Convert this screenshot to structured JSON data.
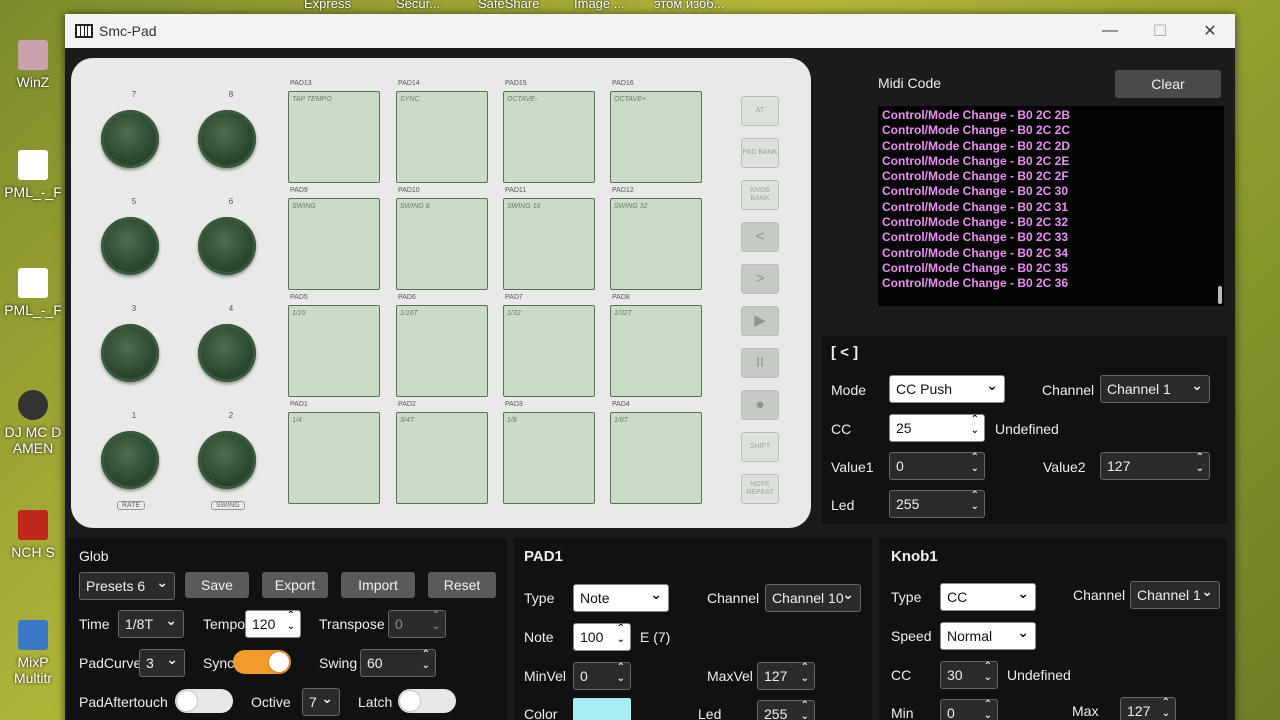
{
  "desktop": {
    "taskbar": [
      "Express",
      "Secur...",
      "SafeShare",
      "Image ...",
      "этом изоб..."
    ],
    "icons": [
      "WinZ",
      "PML_-_F",
      "PML_-_F",
      "DJ MC D\nAMEN",
      "NCH S",
      "MixP\nMultitr"
    ]
  },
  "window": {
    "title": "Smc-Pad",
    "min": "—",
    "max": "☐",
    "close": "✕"
  },
  "device": {
    "knob_labels": [
      "7",
      "8",
      "5",
      "6",
      "3",
      "4",
      "1",
      "2"
    ],
    "tags": [
      "RATE",
      "SWING"
    ],
    "pad_rows": [
      [
        {
          "num": "PAD13",
          "label": "TAP TEMPO"
        },
        {
          "num": "PAD14",
          "label": "SYNC"
        },
        {
          "num": "PAD15",
          "label": "OCTAVE-"
        },
        {
          "num": "PAD16",
          "label": "OCTAVE+"
        }
      ],
      [
        {
          "num": "PAD9",
          "label": "SWING"
        },
        {
          "num": "PAD10",
          "label": "SWING 8"
        },
        {
          "num": "PAD11",
          "label": "SWING 16"
        },
        {
          "num": "PAD12",
          "label": "SWING 32"
        }
      ],
      [
        {
          "num": "PAD5",
          "label": "1/16"
        },
        {
          "num": "PAD6",
          "label": "1/16T"
        },
        {
          "num": "PAD7",
          "label": "1/32"
        },
        {
          "num": "PAD8",
          "label": "1/32T"
        }
      ],
      [
        {
          "num": "PAD1",
          "label": "1/4"
        },
        {
          "num": "PAD2",
          "label": "3/4T"
        },
        {
          "num": "PAD3",
          "label": "1/8"
        },
        {
          "num": "PAD4",
          "label": "1/8T"
        }
      ]
    ],
    "side_buttons": [
      "AT",
      "PAD BANK",
      "KNOB BANK",
      "<",
      ">",
      "▶",
      "II",
      "●",
      "SHIFT",
      "NOTE REPEAT"
    ]
  },
  "midi": {
    "title": "Midi Code",
    "clear": "Clear",
    "lines": [
      "Control/Mode Change - B0 2C 2B",
      "Control/Mode Change - B0 2C 2C",
      "Control/Mode Change - B0 2C 2D",
      "Control/Mode Change - B0 2C 2E",
      "Control/Mode Change - B0 2C 2F",
      "Control/Mode Change - B0 2C 30",
      "Control/Mode Change - B0 2C 31",
      "Control/Mode Change - B0 2C 32",
      "Control/Mode Change - B0 2C 33",
      "Control/Mode Change - B0 2C 34",
      "Control/Mode Change - B0 2C 35",
      "Control/Mode Change - B0 2C 36"
    ]
  },
  "btn_panel": {
    "title": "[ < ]",
    "mode_label": "Mode",
    "mode": "CC Push",
    "channel_label": "Channel",
    "channel": "Channel 1",
    "cc_label": "CC",
    "cc": "25",
    "cc_name": "Undefined",
    "value1_label": "Value1",
    "value1": "0",
    "value2_label": "Value2",
    "value2": "127",
    "led_label": "Led",
    "led": "255"
  },
  "glob": {
    "title": "Glob",
    "preset": "Presets 6",
    "save": "Save",
    "export": "Export",
    "import": "Import",
    "reset": "Reset",
    "time_label": "Time",
    "time": "1/8T",
    "tempo_label": "Tempo",
    "tempo": "120",
    "transpose_label": "Transpose",
    "transpose": "0",
    "padcurve_label": "PadCurve",
    "padcurve": "3",
    "sync_label": "Sync",
    "sync_on": true,
    "swing_label": "Swing",
    "swing": "60",
    "aftertouch_label": "PadAftertouch",
    "aftertouch_on": false,
    "octive_label": "Octive",
    "octive": "7",
    "latch_label": "Latch",
    "latch_on": false
  },
  "pad_panel": {
    "title": "PAD1",
    "type_label": "Type",
    "type": "Note",
    "channel_label": "Channel",
    "channel": "Channel 10",
    "note_label": "Note",
    "note": "100",
    "note_name": "E (7)",
    "minvel_label": "MinVel",
    "minvel": "0",
    "maxvel_label": "MaxVel",
    "maxvel": "127",
    "color_label": "Color",
    "color": "#a8ecf4",
    "led_label": "Led",
    "led": "255"
  },
  "knob_panel": {
    "title": "Knob1",
    "type_label": "Type",
    "type": "CC",
    "channel_label": "Channel",
    "channel": "Channel 1",
    "speed_label": "Speed",
    "speed": "Normal",
    "cc_label": "CC",
    "cc": "30",
    "cc_name": "Undefined",
    "min_label": "Min",
    "min": "0",
    "max_label": "Max",
    "max": "127"
  }
}
